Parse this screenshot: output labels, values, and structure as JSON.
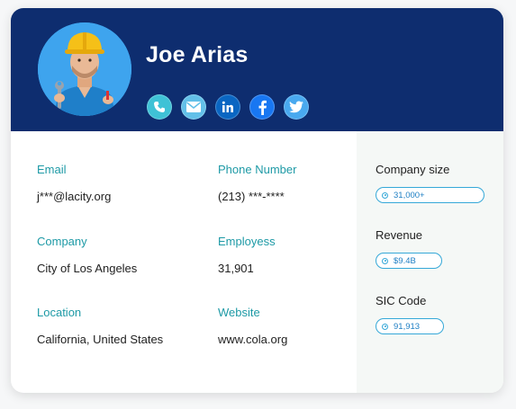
{
  "profile": {
    "name": "Joe Arias",
    "avatar_alt": "construction worker avatar",
    "socials": [
      {
        "icon": "phone-icon"
      },
      {
        "icon": "email-icon"
      },
      {
        "icon": "linkedin-icon"
      },
      {
        "icon": "facebook-icon"
      },
      {
        "icon": "twitter-icon"
      }
    ]
  },
  "details": {
    "email": {
      "label": "Email",
      "value": "j***@lacity.org"
    },
    "phone": {
      "label": "Phone Number",
      "value": "(213) ***-****"
    },
    "company": {
      "label": "Company",
      "value": "City of Los Angeles"
    },
    "employees": {
      "label": "Employess",
      "value": "31,901"
    },
    "location": {
      "label": "Location",
      "value": "California, United States"
    },
    "website": {
      "label": "Website",
      "value": "www.cola.org"
    }
  },
  "company_stats": {
    "size": {
      "label": "Company size",
      "value": "31,000+"
    },
    "revenue": {
      "label": "Revenue",
      "value": "$9.4B"
    },
    "sic": {
      "label": "SIC Code",
      "value": "91,913"
    }
  },
  "colors": {
    "header_bg": "#0e2d6f",
    "accent_label": "#1e9aa6",
    "pill_border": "#35a8d8"
  }
}
